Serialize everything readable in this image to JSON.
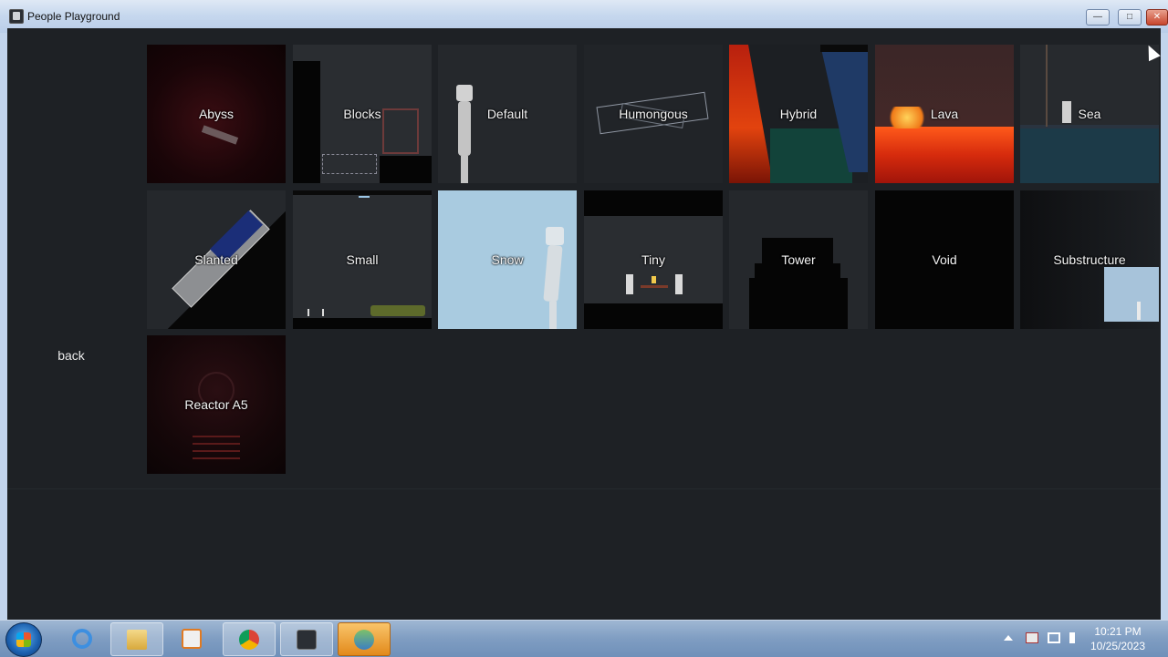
{
  "window": {
    "title": "People Playground",
    "minimize_glyph": "—",
    "maximize_glyph": "□",
    "close_glyph": "✕"
  },
  "maps": [
    {
      "label": "Abyss"
    },
    {
      "label": "Blocks"
    },
    {
      "label": "Default"
    },
    {
      "label": "Humongous"
    },
    {
      "label": "Hybrid"
    },
    {
      "label": "Lava"
    },
    {
      "label": "Sea"
    },
    {
      "label": "Slanted"
    },
    {
      "label": "Small"
    },
    {
      "label": "Snow"
    },
    {
      "label": "Tiny"
    },
    {
      "label": "Tower"
    },
    {
      "label": "Void"
    },
    {
      "label": "Substructure"
    },
    {
      "label": "Reactor A5"
    }
  ],
  "back_label": "back",
  "taskbar": {
    "items": [
      "start-orb",
      "internet-explorer-icon",
      "file-explorer-icon",
      "media-player-icon",
      "chrome-icon",
      "people-playground-icon",
      "network-app-icon"
    ]
  },
  "clock": {
    "time": "10:21 PM",
    "date": "10/25/2023"
  }
}
